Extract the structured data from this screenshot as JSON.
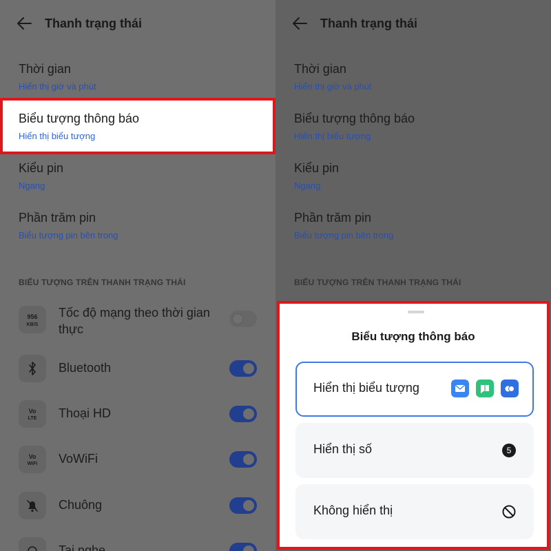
{
  "left": {
    "title": "Thanh trạng thái",
    "settings": [
      {
        "label": "Thời gian",
        "value": "Hiển thị giờ và phút"
      },
      {
        "label": "Biểu tượng thông báo",
        "value": "Hiển thị biểu tượng"
      },
      {
        "label": "Kiểu pin",
        "value": "Ngang"
      },
      {
        "label": "Phần trăm pin",
        "value": "Biểu tượng pin bên trong"
      }
    ],
    "section_label": "BIỂU TƯỢNG TRÊN THANH TRẠNG THÁI",
    "icon_rows": [
      {
        "label_line1": "Tốc độ mạng theo thời gian",
        "label_line2": "thực",
        "icon": "network-speed-icon",
        "icon_text_top": "956",
        "icon_text_bottom": "KB/S",
        "enabled": false
      },
      {
        "label": "Bluetooth",
        "icon": "bluetooth-icon",
        "enabled": true
      },
      {
        "label": "Thoại HD",
        "icon": "volte-icon",
        "icon_text_top": "Vo",
        "icon_text_bottom": "LTE",
        "enabled": true
      },
      {
        "label": "VoWiFi",
        "icon": "vowifi-icon",
        "icon_text_top": "Vo",
        "icon_text_bottom": "WiFi",
        "enabled": true
      },
      {
        "label": "Chuông",
        "icon": "bell-muted-icon",
        "enabled": true
      },
      {
        "label": "Tai nghe",
        "icon": "headphone-icon",
        "enabled": true
      }
    ]
  },
  "right": {
    "title": "Thanh trạng thái",
    "settings": [
      {
        "label": "Thời gian",
        "value": "Hiển thị giờ và phút"
      },
      {
        "label": "Biểu tượng thông báo",
        "value": "Hiển thị biểu tượng"
      },
      {
        "label": "Kiểu pin",
        "value": "Ngang"
      },
      {
        "label": "Phần trăm pin",
        "value": "Biểu tượng pin bên trong"
      }
    ],
    "section_label": "BIỂU TƯỢNG TRÊN THANH TRẠNG THÁI",
    "sheet": {
      "title": "Biểu tượng thông báo",
      "options": [
        {
          "label": "Hiển thị biểu tượng",
          "selected": true,
          "preview": [
            "mail-app-icon",
            "messages-app-icon",
            "chat-app-icon"
          ]
        },
        {
          "label": "Hiển thị số",
          "selected": false,
          "preview_number": "5"
        },
        {
          "label": "Không hiển thị",
          "selected": false,
          "preview": "prohibited-icon"
        }
      ]
    }
  },
  "colors": {
    "accent": "#3c78e6",
    "highlight_border": "#e0161b",
    "toggle_on": "#223e8f",
    "link": "#2a4fb0"
  }
}
